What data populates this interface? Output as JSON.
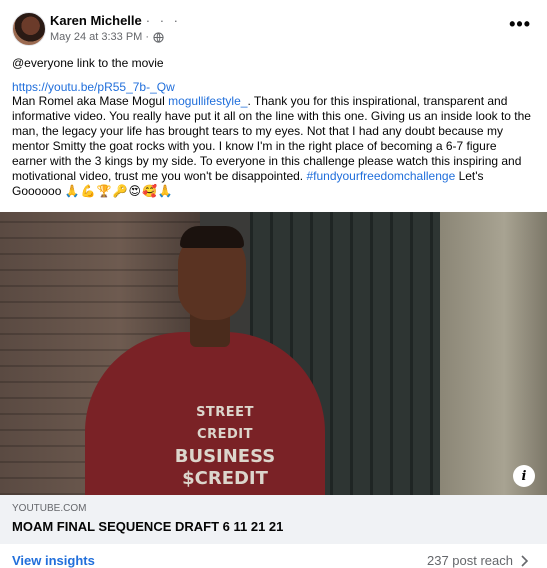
{
  "post": {
    "author": "Karen Michelle",
    "author_suffix": "· · ·",
    "timestamp": "May 24 at 3:33 PM ·",
    "more_label": "•••",
    "mention_line": "@everyone link to the movie",
    "url": "https://youtu.be/pR55_7b-_Qw",
    "body_part1": "Man Romel aka Mase Mogul ",
    "body_mention": "mogullifestyle_",
    "body_part2": ". Thank you for this inspirational, transparent and informative video. You really have put it all on the line with this one. Giving us an inside look to the man, the legacy your life has brought tears to my eyes. Not that I had any doubt because my mentor Smitty the goat rocks with you. I know I'm in the right place of becoming a 6-7 figure earner with the 3 kings by my side. To everyone in this challenge please watch this inspiring and motivational video, trust me you won't be disappointed. ",
    "hashtag": "#fundyourfreedomchallenge",
    "body_part3": " Let's Goooooo ",
    "emojis": "🙏💪🏆🔑😍🥰🙏"
  },
  "media": {
    "shirt_line1": "STREET CREDIT",
    "shirt_line2": "BUSINESS",
    "shirt_line3": "$CREDIT"
  },
  "link_preview": {
    "domain": "YOUTUBE.COM",
    "title": "MOAM FINAL SEQUENCE DRAFT 6 11 21 21"
  },
  "footer": {
    "insights_label": "View insights",
    "reach_label": "237 post reach"
  }
}
